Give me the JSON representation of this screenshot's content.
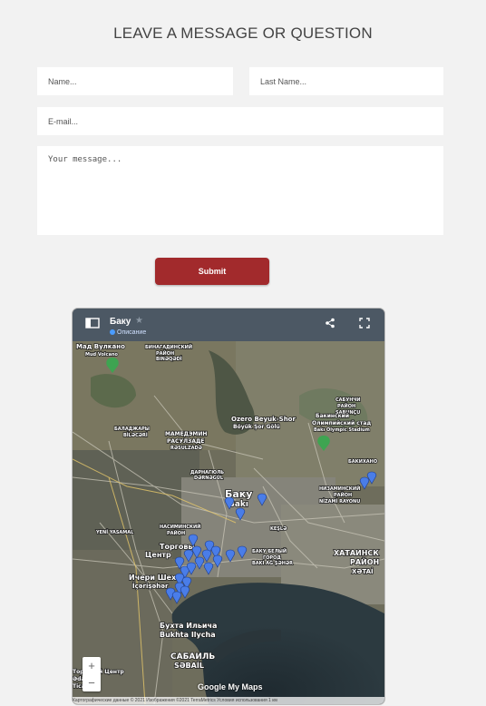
{
  "form": {
    "title": "LEAVE A MESSAGE OR QUESTION",
    "name_placeholder": "Name...",
    "lastname_placeholder": "Last Name...",
    "email_placeholder": "E-mail...",
    "message_placeholder": "Your message...",
    "submit_label": "Submit"
  },
  "map": {
    "title": "Баку",
    "description_link": "Описание",
    "icons": {
      "sidebar": "sidebar-toggle-icon",
      "share": "share-icon",
      "fullscreen": "fullscreen-icon",
      "star": "star-icon"
    },
    "labels": {
      "mud_volcano": "Мад Вулкано",
      "mud_volcano_sub": "Mud Volcano",
      "binagadi": "БИНАГАДИНСКИЙ",
      "binagadi2": "РАЙОН",
      "binagadi3": "BINƏQƏDİ",
      "sabunchu": "САБУНЧИ",
      "sabunchu2": "РАЙОН",
      "sabunchu3": "SABUNÇU",
      "lake": "Ozero Beyuk-Shor",
      "lake_sub": "Böyük Şor Gölü",
      "stadium": "Бакинский",
      "stadium2": "Олимпийский стад",
      "stadium3": "Bakı Olympic Stadium",
      "baladzhary": "БАЛАДЖАРЫ",
      "baladzhary2": "BİLƏCƏRİ",
      "rasulzade": "МАМЕДЭМИН",
      "rasulzade2": "РАСУЛЗАДЕ",
      "rasulzade3": "RƏSULZADƏ",
      "darnagul": "ДАРНАГЮЛЬ",
      "darnagul2": "DƏRNƏGÜL",
      "baku": "Баку",
      "baku2": "Bakı",
      "keshla": "KEŞLƏ",
      "bakikhanov": "БАКИХАНО",
      "nizami": "НИЗАМИНСКИЙ",
      "nizami2": "РАЙОН",
      "nizami3": "NİZAMİ RAYONU",
      "yeni_yasamal": "YENİ YASAMAL",
      "nasimi": "НАСИМИНСКИЙ",
      "nasimi2": "РАЙОН",
      "torgovy": "Торговы",
      "torgovy2": "Центр",
      "icheri": "Ичери Шехе",
      "icheri2": "İçərişəhər",
      "white_city": "БАКУ БЕЛЫЙ",
      "white_city2": "ГОРОД",
      "white_city3": "BAKI AĞ ŞƏHƏR",
      "khatai": "ХАТАИНСК",
      "khatai2": "РАЙОН",
      "khatai3": "XƏTAİ",
      "ilyich": "Бухта Ильича",
      "ilyich2": "Bukhta Ilycha",
      "sabail": "САБАИЛЬ",
      "sabail2": "SƏBAİL",
      "lokbatan_center": "Торговый Центр",
      "lokbatan2": "Ədalət",
      "lokbatan3": "Ticarət"
    },
    "zoom_in": "+",
    "zoom_out": "−",
    "logo_text": "Google My Maps",
    "footer": "Картографические данные © 2021 Изображения ©2021 TerraMetrics     Условия использования     1 км"
  }
}
